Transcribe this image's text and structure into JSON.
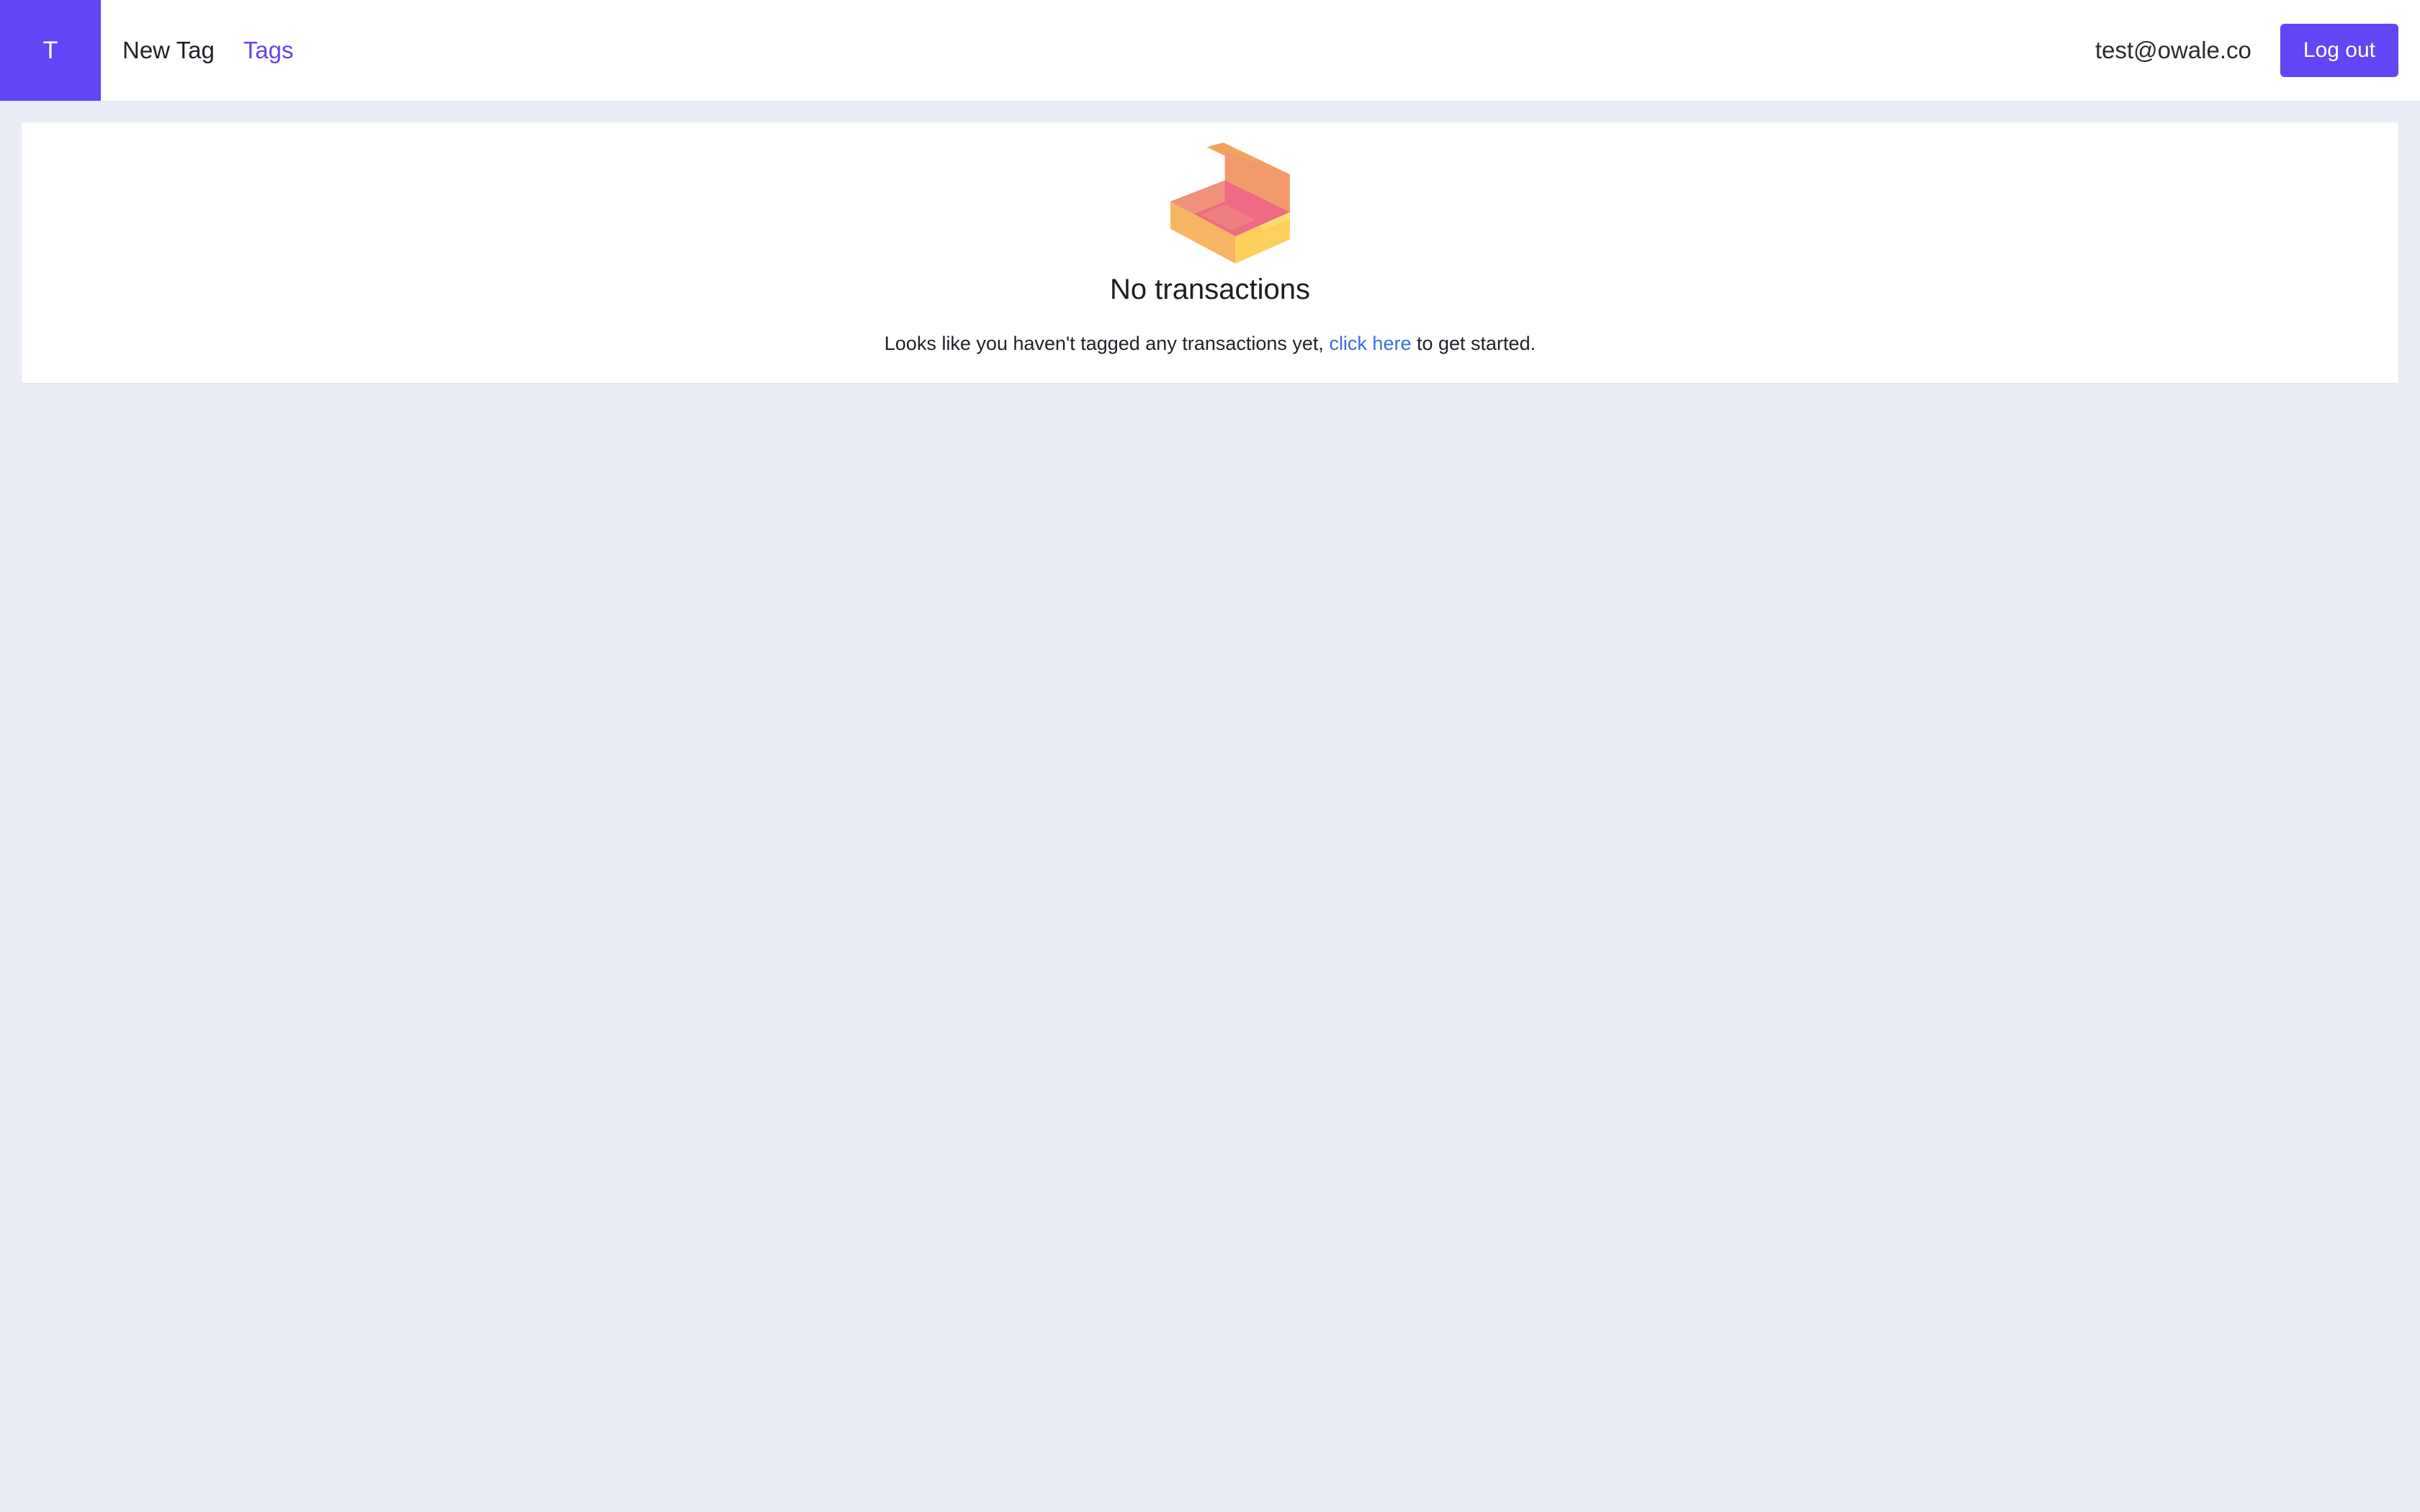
{
  "app": {
    "logo_letter": "T"
  },
  "nav": {
    "items": [
      {
        "label": "New Tag"
      },
      {
        "label": "Tags"
      }
    ]
  },
  "user": {
    "email": "test@owale.co",
    "logout_label": "Log out"
  },
  "empty_state": {
    "title": "No transactions",
    "message_before": "Looks like you haven't tagged any transactions yet, ",
    "link_text": "click here",
    "message_after": " to get started.",
    "icon": "open-box-icon"
  },
  "colors": {
    "accent": "#6346f5",
    "link": "#3b6fe0",
    "background": "#eaedf5"
  }
}
